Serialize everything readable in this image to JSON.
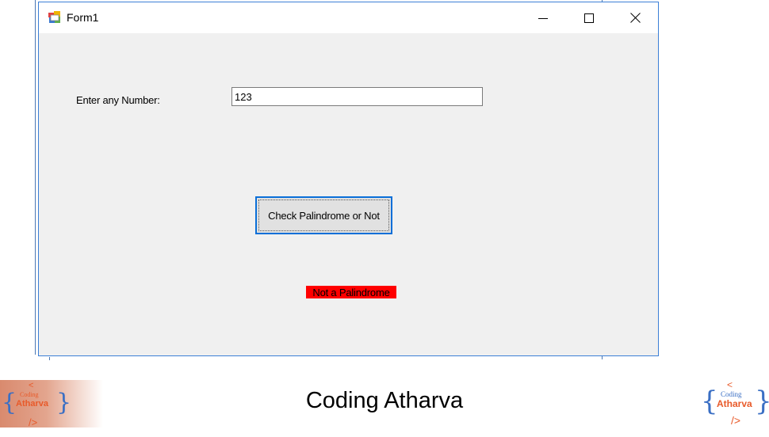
{
  "window": {
    "title": "Form1",
    "controls": {
      "minimize_icon": "minimize-icon",
      "maximize_icon": "maximize-icon",
      "close_icon": "close-icon"
    }
  },
  "form": {
    "number_label": "Enter any Number:",
    "number_value": "123",
    "check_button_label": "Check Palindrome or Not",
    "result_text": "Not a Palindrome",
    "result_bg_color": "#ff0000"
  },
  "footer": {
    "title": "Coding Atharva",
    "logo_text_top": "Coding",
    "logo_text_main": "Atharva",
    "logo_left_lt": "<",
    "logo_left_gt": "/>",
    "logo_right_lt": "<",
    "logo_right_gt": "/>"
  },
  "colors": {
    "accent": "#0a6fd8",
    "window_border": "#3c7fd6",
    "logo_orange": "#e85a2a",
    "logo_blue": "#3a6fc4"
  }
}
